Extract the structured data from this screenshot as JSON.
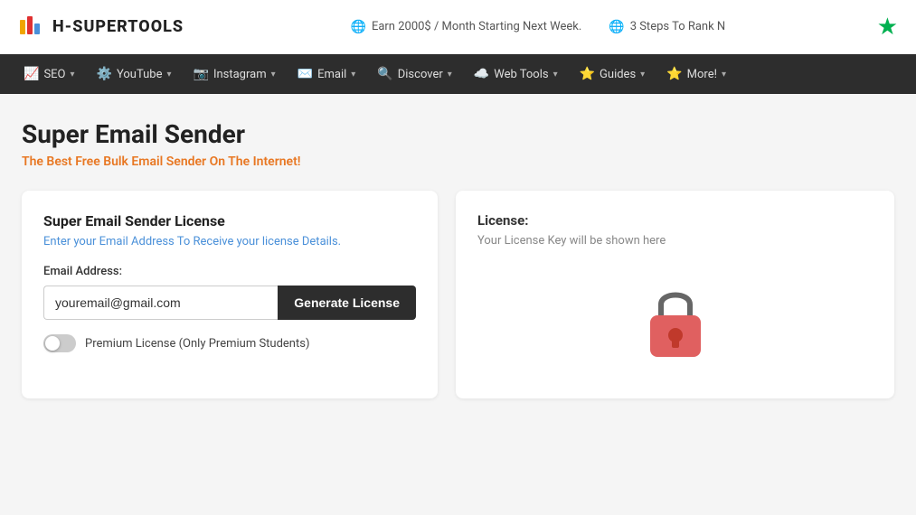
{
  "brand": {
    "name": "H-SUPERTOOLS"
  },
  "topbar": {
    "promo1": "Earn 2000$ / Month Starting Next Week.",
    "promo2": "3 Steps To Rank N",
    "star_label": "★"
  },
  "nav": {
    "items": [
      {
        "label": "SEO",
        "icon": "📈"
      },
      {
        "label": "YouTube",
        "icon": "⚙️"
      },
      {
        "label": "Instagram",
        "icon": "📷"
      },
      {
        "label": "Email",
        "icon": "✉️"
      },
      {
        "label": "Discover",
        "icon": "🔍"
      },
      {
        "label": "Web Tools",
        "icon": "☁️"
      },
      {
        "label": "Guides",
        "icon": "⭐"
      },
      {
        "label": "More!",
        "icon": "⭐"
      }
    ]
  },
  "page": {
    "title": "Super Email Sender",
    "subtitle": "The Best Free Bulk Email Sender On The Internet!"
  },
  "left_card": {
    "title": "Super Email Sender License",
    "hint": "Enter your Email Address To Receive your license Details.",
    "email_label": "Email Address:",
    "email_placeholder": "youremail@gmail.com",
    "button_label": "Generate License",
    "toggle_label": "Premium License (Only Premium Students)"
  },
  "right_card": {
    "license_title": "License:",
    "license_hint": "Your License Key will be shown here"
  }
}
